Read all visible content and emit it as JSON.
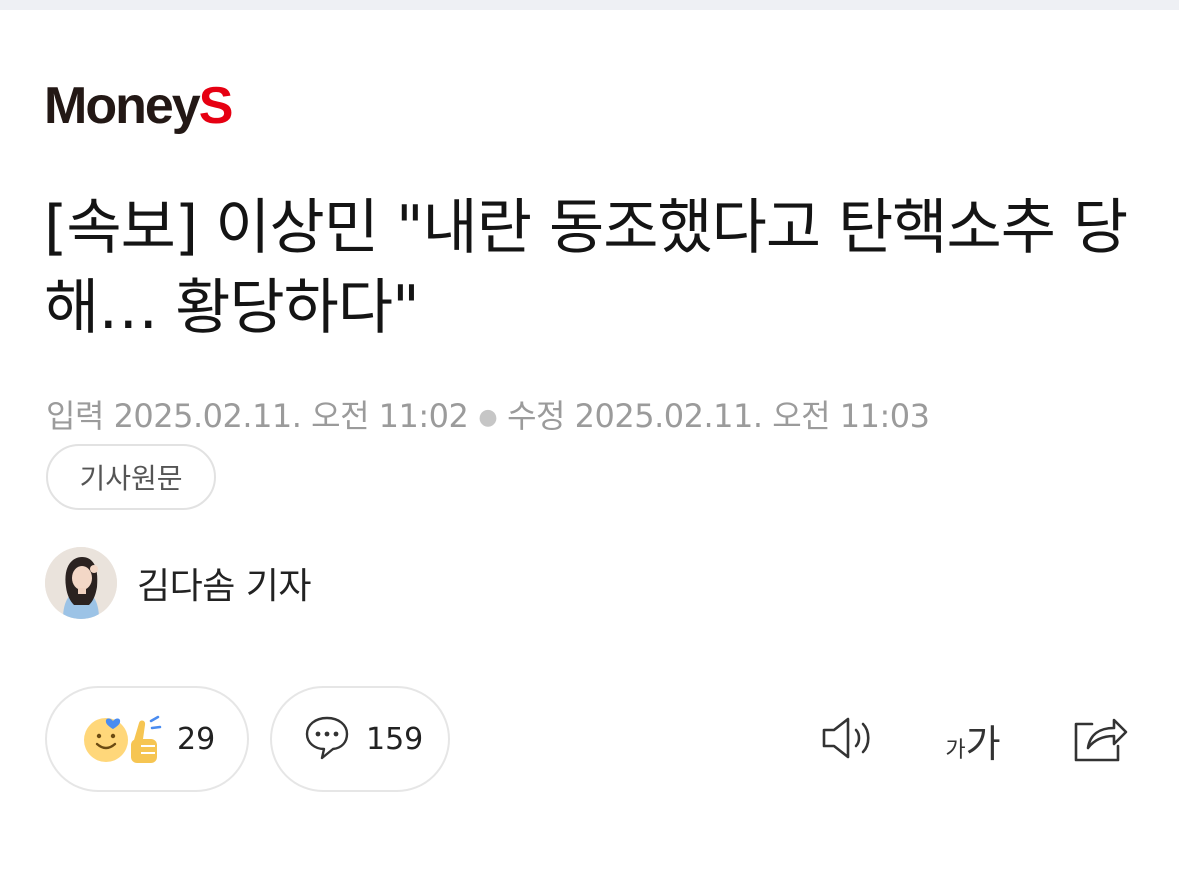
{
  "logo": {
    "text_main": "Money",
    "text_accent": "S",
    "accent_color": "#e60012"
  },
  "article": {
    "title": "[속보] 이상민 \"내란 동조했다고 탄핵소추 당해… 황당하다\"",
    "input_label": "입력",
    "input_time": "2025.02.11. 오전 11:02",
    "edit_label": "수정",
    "edit_time": "2025.02.11. 오전 11:03",
    "original_button": "기사원문"
  },
  "author": {
    "name": "김다솜 기자"
  },
  "actions": {
    "reaction_count": "29",
    "comment_count": "159",
    "font_size_small": "가",
    "font_size_large": "가"
  },
  "icons": {
    "reaction": "smile-thumbs-up-icon",
    "comment": "speech-bubble-icon",
    "speaker": "speaker-icon",
    "font_size": "font-size-icon",
    "share": "share-icon"
  }
}
